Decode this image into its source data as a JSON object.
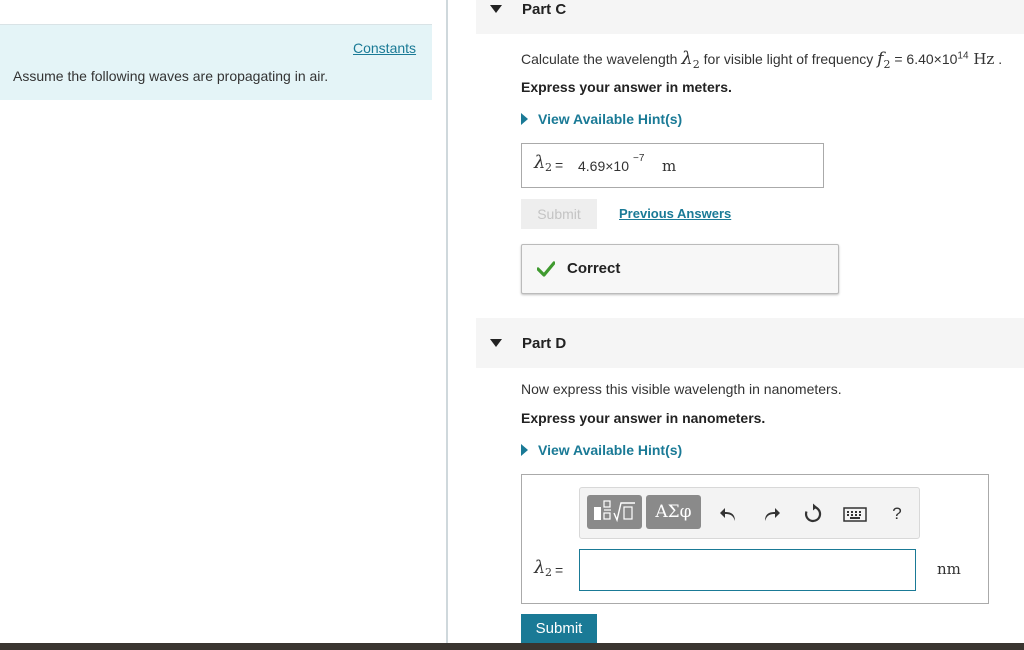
{
  "left": {
    "constants_link": "Constants",
    "info_text": "Assume the following waves are propagating in air."
  },
  "part_c": {
    "title": "Part C",
    "question_prefix": "Calculate the wavelength ",
    "question_var": "λ",
    "question_var_sub": "2",
    "question_mid": " for visible light of frequency ",
    "freq_var": "f",
    "freq_var_sub": "2",
    "freq_eq": " = 6.40×10",
    "freq_exp": "14",
    "freq_unit": " Hz",
    "freq_end": " .",
    "instruction": "Express your answer in meters.",
    "hint_label": "View Available Hint(s)",
    "answer_var": "λ",
    "answer_var_sub": "2",
    "answer_eq": " = ",
    "answer_mantissa": "4.69×10",
    "answer_exp": "−7",
    "answer_unit": "m",
    "submit_label": "Submit",
    "previous_answers_label": "Previous Answers",
    "feedback_label": "Correct",
    "feedback_color": "#3f9a2f"
  },
  "part_d": {
    "title": "Part D",
    "question": "Now express this visible wavelength in nanometers.",
    "instruction": "Express your answer in nanometers.",
    "hint_label": "View Available Hint(s)",
    "toolbar": {
      "templates_icon": "fraction-sqrt-template-icon",
      "symbols_label": "ΑΣφ",
      "undo_icon": "undo-icon",
      "redo_icon": "redo-icon",
      "reset_icon": "reset-icon",
      "keyboard_icon": "keyboard-icon",
      "help_label": "?"
    },
    "answer_var": "λ",
    "answer_var_sub": "2",
    "answer_eq": " = ",
    "input_value": "",
    "unit": "nm",
    "submit_label": "Submit"
  },
  "colors": {
    "accent": "#1a7a96",
    "info_bg": "#e4f4f7",
    "header_bg": "#f5f5f5"
  }
}
